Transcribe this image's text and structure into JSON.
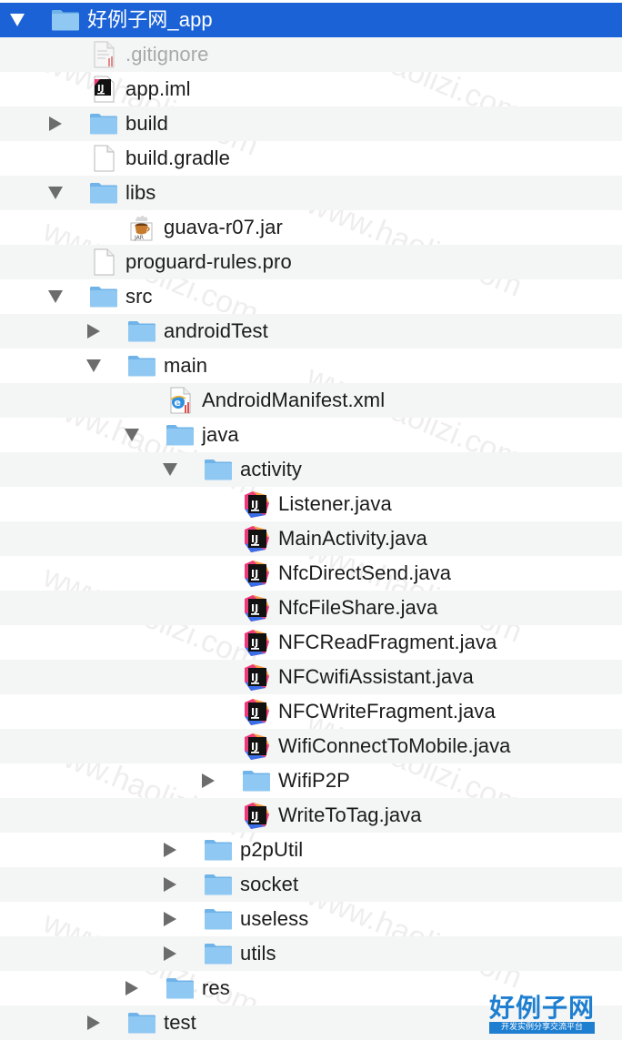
{
  "tree": [
    {
      "label": "好例子网_app",
      "depth": 0,
      "icon": "folder-icon",
      "expander": "expanded",
      "selected": true
    },
    {
      "label": ".gitignore",
      "depth": 1,
      "icon": "gitignore-file-icon",
      "expander": "none",
      "dim": true
    },
    {
      "label": "app.iml",
      "depth": 1,
      "icon": "intellij-module-icon",
      "expander": "none"
    },
    {
      "label": "build",
      "depth": 1,
      "icon": "folder-icon",
      "expander": "collapsed"
    },
    {
      "label": "build.gradle",
      "depth": 1,
      "icon": "blank-file-icon",
      "expander": "none"
    },
    {
      "label": "libs",
      "depth": 1,
      "icon": "folder-icon",
      "expander": "expanded"
    },
    {
      "label": "guava-r07.jar",
      "depth": 2,
      "icon": "jar-file-icon",
      "expander": "none"
    },
    {
      "label": "proguard-rules.pro",
      "depth": 1,
      "icon": "blank-file-icon",
      "expander": "none"
    },
    {
      "label": "src",
      "depth": 1,
      "icon": "folder-icon",
      "expander": "expanded"
    },
    {
      "label": "androidTest",
      "depth": 2,
      "icon": "folder-icon",
      "expander": "collapsed"
    },
    {
      "label": "main",
      "depth": 2,
      "icon": "folder-icon",
      "expander": "expanded"
    },
    {
      "label": "AndroidManifest.xml",
      "depth": 3,
      "icon": "xml-file-icon",
      "expander": "none"
    },
    {
      "label": "java",
      "depth": 3,
      "icon": "folder-icon",
      "expander": "expanded"
    },
    {
      "label": "activity",
      "depth": 4,
      "icon": "folder-icon",
      "expander": "expanded"
    },
    {
      "label": "Listener.java",
      "depth": 5,
      "icon": "intellij-java-file-icon",
      "expander": "none"
    },
    {
      "label": "MainActivity.java",
      "depth": 5,
      "icon": "intellij-java-file-icon",
      "expander": "none"
    },
    {
      "label": "NfcDirectSend.java",
      "depth": 5,
      "icon": "intellij-java-file-icon",
      "expander": "none"
    },
    {
      "label": "NfcFileShare.java",
      "depth": 5,
      "icon": "intellij-java-file-icon",
      "expander": "none"
    },
    {
      "label": "NFCReadFragment.java",
      "depth": 5,
      "icon": "intellij-java-file-icon",
      "expander": "none"
    },
    {
      "label": "NFCwifiAssistant.java",
      "depth": 5,
      "icon": "intellij-java-file-icon",
      "expander": "none"
    },
    {
      "label": "NFCWriteFragment.java",
      "depth": 5,
      "icon": "intellij-java-file-icon",
      "expander": "none"
    },
    {
      "label": "WifiConnectToMobile.java",
      "depth": 5,
      "icon": "intellij-java-file-icon",
      "expander": "none"
    },
    {
      "label": "WifiP2P",
      "depth": 5,
      "icon": "folder-icon",
      "expander": "collapsed"
    },
    {
      "label": "WriteToTag.java",
      "depth": 5,
      "icon": "intellij-java-file-icon",
      "expander": "none"
    },
    {
      "label": "p2pUtil",
      "depth": 4,
      "icon": "folder-icon",
      "expander": "collapsed"
    },
    {
      "label": "socket",
      "depth": 4,
      "icon": "folder-icon",
      "expander": "collapsed"
    },
    {
      "label": "useless",
      "depth": 4,
      "icon": "folder-icon",
      "expander": "collapsed"
    },
    {
      "label": "utils",
      "depth": 4,
      "icon": "folder-icon",
      "expander": "collapsed"
    },
    {
      "label": "res",
      "depth": 3,
      "icon": "folder-icon",
      "expander": "collapsed"
    },
    {
      "label": "test",
      "depth": 2,
      "icon": "folder-icon",
      "expander": "collapsed"
    }
  ],
  "watermark": {
    "text": "www.haolizi.com"
  },
  "logo": {
    "main": "好例子网",
    "sub": "开发实例分享交流平台"
  },
  "colors": {
    "selection": "#1a62d6",
    "folder": "#8fc8f2",
    "alt_row": "#f4f5f5",
    "logo": "#1e7fd0"
  }
}
